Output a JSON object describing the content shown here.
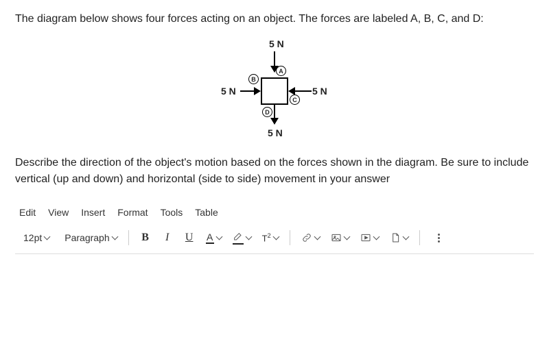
{
  "question_intro": "The diagram below shows four forces acting on an object. The forces are labeled A, B, C, and D:",
  "question_prompt": "Describe the direction of the object's motion based on the forces shown in the diagram. Be sure to include vertical (up and down) and horizontal (side to side) movement in your answer",
  "forces": {
    "top": {
      "letter": "A",
      "value": "5 N"
    },
    "left": {
      "letter": "B",
      "value": "5 N"
    },
    "right": {
      "letter": "C",
      "value": "5 N"
    },
    "bottom": {
      "letter": "D",
      "value": "5 N"
    }
  },
  "menubar": {
    "edit": "Edit",
    "view": "View",
    "insert": "Insert",
    "format": "Format",
    "tools": "Tools",
    "table": "Table"
  },
  "toolbar": {
    "fontsize": "12pt",
    "blocktype": "Paragraph",
    "bold": "B",
    "italic": "I",
    "underline": "U",
    "fontcolor_a": "A",
    "superscript": "T²"
  }
}
